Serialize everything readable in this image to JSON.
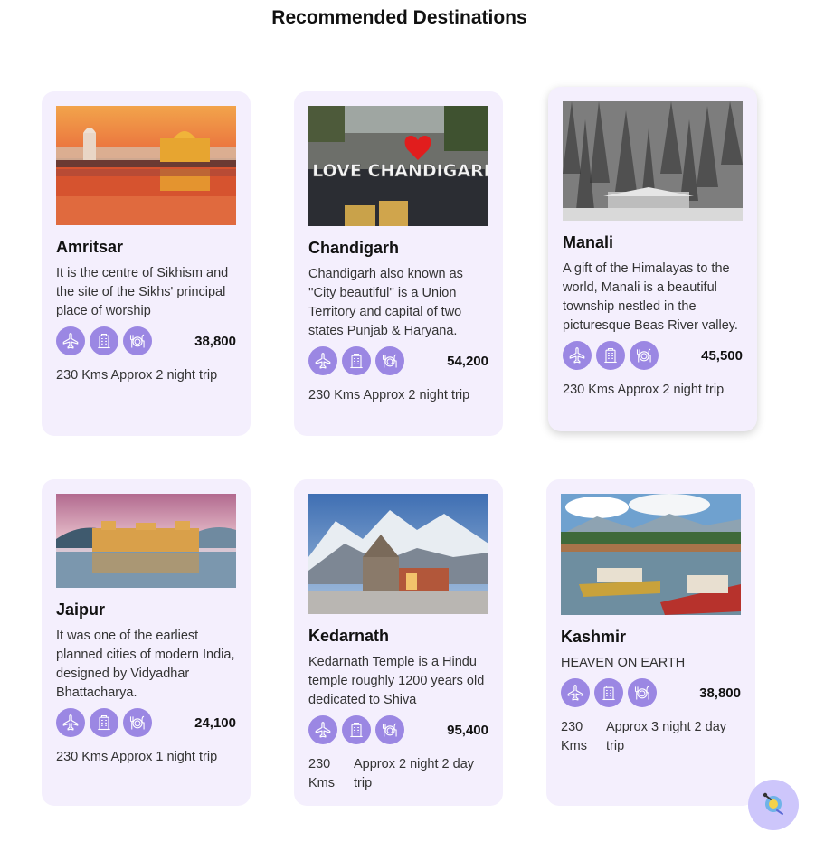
{
  "page": {
    "title": "Recommended Destinations"
  },
  "colors": {
    "card_bg": "#f4effd",
    "icon_bg": "#9b87e3",
    "fab_bg": "#cdc6fb"
  },
  "feature_icons": [
    "airplane-icon",
    "hotel-icon",
    "meal-icon"
  ],
  "destinations": [
    {
      "name": "Amritsar",
      "description": "It is the centre of Sikhism and the site of the Sikhs' principal place of worship",
      "price": "38,800",
      "trip": "230 Kms Approx 2 night trip",
      "image": "golden-temple-sunset"
    },
    {
      "name": "Chandigarh",
      "description": "Chandigarh also known as ''City beautiful'' is a Union Territory and capital of two states Punjab & Haryana.",
      "price": "54,200",
      "trip": "230 Kms Approx 2 night trip",
      "image": "i-love-chandigarh-sign",
      "image_text": "I LOVE CHANDIGARH"
    },
    {
      "name": "Manali",
      "description": "A gift of the Himalayas to the world, Manali is a beautiful township nestled in the picturesque Beas River valley.",
      "price": "45,500",
      "trip": "230 Kms Approx 2 night trip",
      "image": "snowy-forest"
    },
    {
      "name": "Jaipur",
      "description": "It was one of the earliest planned cities of modern India, designed by Vidyadhar Bhattacharya.",
      "price": "24,100",
      "trip": "230 Kms Approx 1 night trip",
      "image": "jal-mahal"
    },
    {
      "name": "Kedarnath",
      "description": "Kedarnath Temple is a Hindu temple roughly 1200 years old dedicated to Shiva",
      "price": "95,400",
      "trip_distance": "230 Kms",
      "trip_detail": "Approx 2 night 2 day trip",
      "image": "kedarnath-temple"
    },
    {
      "name": "Kashmir",
      "description": "HEAVEN ON EARTH",
      "price": "38,800",
      "trip_distance": "230 Kms",
      "trip_detail": "Approx 3 night 2 day trip",
      "image": "dal-lake-shikaras"
    }
  ],
  "chat_button": {
    "icon": "chatbot-icon"
  }
}
